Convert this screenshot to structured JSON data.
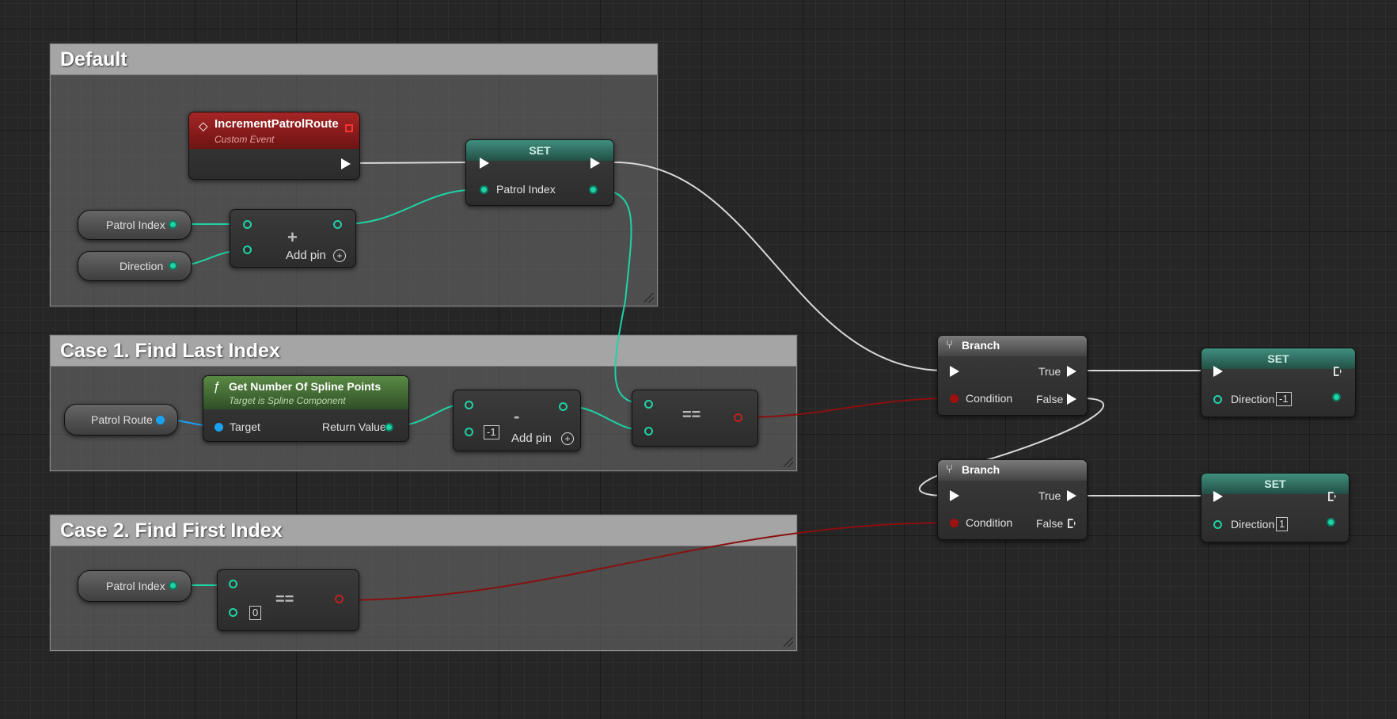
{
  "comments": {
    "default": "Default",
    "case1": "Case 1. Find Last Index",
    "case2": "Case 2. Find First Index"
  },
  "nodes": {
    "event": {
      "title": "IncrementPatrolRoute",
      "subtitle": "Custom Event"
    },
    "set_main": {
      "title": "SET",
      "pin": "Patrol Index"
    },
    "patrol_index_var": "Patrol Index",
    "direction_var": "Direction",
    "add_node": {
      "op": "+",
      "add_pin": "Add pin"
    },
    "patrol_route_var": "Patrol Route",
    "get_spline": {
      "title": "Get Number Of Spline Points",
      "subtitle": "Target is Spline Component",
      "in_pin": "Target",
      "out_pin": "Return Value"
    },
    "subtract_node": {
      "op": "-",
      "literal": "-1",
      "add_pin": "Add pin"
    },
    "equals_case1": {
      "op": "=="
    },
    "patrol_index_var2": "Patrol Index",
    "equals_case2": {
      "op": "==",
      "literal": "0"
    },
    "branch1": {
      "title": "Branch",
      "true": "True",
      "false": "False",
      "condition": "Condition"
    },
    "branch2": {
      "title": "Branch",
      "true": "True",
      "false": "False",
      "condition": "Condition"
    },
    "set_dir1": {
      "title": "SET",
      "pin": "Direction",
      "literal": "-1"
    },
    "set_dir2": {
      "title": "SET",
      "pin": "Direction",
      "literal": "1"
    }
  },
  "colors": {
    "event_header": "#8a1a1a",
    "set_header": "#2e7f6e",
    "function_header": "#4f7a3a",
    "branch_header": "#5a5a5a",
    "float_wire": "#1ed3a5",
    "bool_wire": "#8a0f0f",
    "exec_wire": "#d8d8d8",
    "object_wire": "#1aa1f0"
  }
}
